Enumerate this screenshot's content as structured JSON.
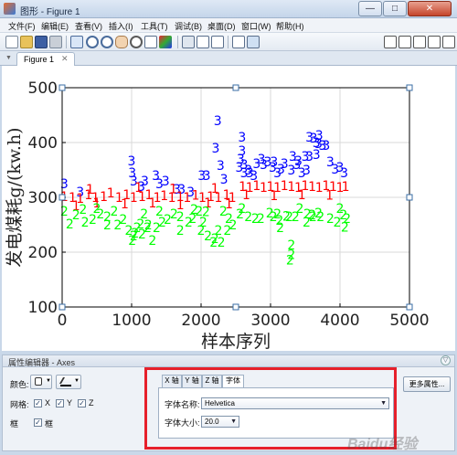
{
  "window": {
    "title": "图形 - Figure 1",
    "min": "—",
    "max": "□",
    "close": "✕"
  },
  "menu": [
    "文件(F)",
    "编辑(E)",
    "查看(V)",
    "插入(I)",
    "工具(T)",
    "调试(B)",
    "桌面(D)",
    "窗口(W)",
    "帮助(H)"
  ],
  "tab": {
    "label": "Figure 1",
    "close": "✕"
  },
  "chart_data": {
    "type": "scatter",
    "xlabel": "样本序列",
    "ylabel": "发电煤耗g/(kw.h)",
    "xlim": [
      0,
      5000
    ],
    "ylim": [
      100,
      500
    ],
    "xticks": [
      "0",
      "1000",
      "2000",
      "3000",
      "4000",
      "5000"
    ],
    "yticks": [
      "100",
      "200",
      "300",
      "400",
      "500"
    ],
    "grid": true,
    "series": [
      {
        "marker": "3",
        "color": "#0000ff",
        "points": [
          [
            30,
            325
          ],
          [
            260,
            310
          ],
          [
            1000,
            367
          ],
          [
            1010,
            345
          ],
          [
            1030,
            330
          ],
          [
            1140,
            320
          ],
          [
            1190,
            330
          ],
          [
            1350,
            340
          ],
          [
            1400,
            325
          ],
          [
            1490,
            330
          ],
          [
            1650,
            315
          ],
          [
            1720,
            315
          ],
          [
            1850,
            310
          ],
          [
            2010,
            340
          ],
          [
            2080,
            340
          ],
          [
            2210,
            390
          ],
          [
            2280,
            358
          ],
          [
            2330,
            333
          ],
          [
            2570,
            370
          ],
          [
            2620,
            345
          ],
          [
            2700,
            345
          ],
          [
            2760,
            340
          ],
          [
            2870,
            370
          ],
          [
            2960,
            365
          ],
          [
            3030,
            355
          ],
          [
            3100,
            345
          ],
          [
            3200,
            362
          ],
          [
            3320,
            375
          ],
          [
            3400,
            367
          ],
          [
            3500,
            375
          ],
          [
            3560,
            375
          ],
          [
            3660,
            400
          ],
          [
            3690,
            398
          ],
          [
            3750,
            395
          ],
          [
            3800,
            395
          ],
          [
            3860,
            365
          ],
          [
            3930,
            352
          ],
          [
            4000,
            355
          ],
          [
            4060,
            345
          ],
          [
            3560,
            410
          ],
          [
            3620,
            408
          ],
          [
            3700,
            413
          ],
          [
            3520,
            350
          ],
          [
            3450,
            345
          ],
          [
            3300,
            350
          ],
          [
            3150,
            352
          ],
          [
            3050,
            365
          ],
          [
            2900,
            360
          ],
          [
            2800,
            362
          ],
          [
            2620,
            360
          ],
          [
            2550,
            355
          ],
          [
            2240,
            440
          ],
          [
            2590,
            410
          ],
          [
            2590,
            385
          ],
          [
            3660,
            378
          ],
          [
            3380,
            360
          ],
          [
            2680,
            350
          ]
        ]
      },
      {
        "marker": "1",
        "color": "#ff0000",
        "points": [
          [
            30,
            302
          ],
          [
            150,
            300
          ],
          [
            260,
            298
          ],
          [
            380,
            305
          ],
          [
            480,
            300
          ],
          [
            600,
            302
          ],
          [
            700,
            308
          ],
          [
            820,
            300
          ],
          [
            930,
            305
          ],
          [
            1030,
            300
          ],
          [
            1150,
            302
          ],
          [
            1250,
            305
          ],
          [
            1370,
            300
          ],
          [
            1470,
            303
          ],
          [
            1580,
            300
          ],
          [
            1700,
            302
          ],
          [
            1800,
            300
          ],
          [
            1920,
            304
          ],
          [
            2020,
            300
          ],
          [
            2140,
            302
          ],
          [
            2250,
            300
          ],
          [
            2370,
            305
          ],
          [
            2450,
            300
          ],
          [
            2600,
            320
          ],
          [
            2700,
            318
          ],
          [
            2800,
            322
          ],
          [
            2900,
            318
          ],
          [
            3000,
            320
          ],
          [
            3100,
            318
          ],
          [
            3200,
            322
          ],
          [
            3300,
            320
          ],
          [
            3400,
            318
          ],
          [
            3500,
            322
          ],
          [
            3600,
            320
          ],
          [
            3700,
            318
          ],
          [
            3800,
            322
          ],
          [
            3900,
            320
          ],
          [
            4000,
            318
          ],
          [
            4080,
            320
          ],
          [
            200,
            285
          ],
          [
            500,
            290
          ],
          [
            900,
            288
          ],
          [
            1300,
            290
          ],
          [
            1700,
            287
          ],
          [
            2100,
            290
          ],
          [
            2400,
            288
          ],
          [
            2650,
            305
          ],
          [
            3050,
            303
          ],
          [
            3450,
            305
          ],
          [
            3850,
            304
          ],
          [
            400,
            315
          ],
          [
            1100,
            318
          ],
          [
            1600,
            316
          ],
          [
            2200,
            317
          ]
        ]
      },
      {
        "marker": "2",
        "color": "#00ff00",
        "points": [
          [
            30,
            275
          ],
          [
            110,
            252
          ],
          [
            200,
            268
          ],
          [
            330,
            255
          ],
          [
            440,
            260
          ],
          [
            550,
            270
          ],
          [
            650,
            265
          ],
          [
            800,
            250
          ],
          [
            880,
            260
          ],
          [
            960,
            240
          ],
          [
            1030,
            230
          ],
          [
            1080,
            245
          ],
          [
            1180,
            270
          ],
          [
            1240,
            250
          ],
          [
            1360,
            245
          ],
          [
            1440,
            255
          ],
          [
            1520,
            260
          ],
          [
            1610,
            270
          ],
          [
            1700,
            265
          ],
          [
            1820,
            255
          ],
          [
            1880,
            262
          ],
          [
            1970,
            275
          ],
          [
            2030,
            255
          ],
          [
            2100,
            230
          ],
          [
            2200,
            225
          ],
          [
            2250,
            240
          ],
          [
            2320,
            275
          ],
          [
            2400,
            262
          ],
          [
            2460,
            250
          ],
          [
            1130,
            252
          ],
          [
            1150,
            233
          ],
          [
            1300,
            222
          ],
          [
            1010,
            222
          ],
          [
            1050,
            235
          ],
          [
            2180,
            218
          ],
          [
            2290,
            218
          ],
          [
            2590,
            280
          ],
          [
            2680,
            265
          ],
          [
            2780,
            262
          ],
          [
            2860,
            262
          ],
          [
            2990,
            272
          ],
          [
            3040,
            265
          ],
          [
            3130,
            258
          ],
          [
            3230,
            266
          ],
          [
            3360,
            265
          ],
          [
            3420,
            280
          ],
          [
            3530,
            270
          ],
          [
            3610,
            265
          ],
          [
            3690,
            272
          ],
          [
            3720,
            265
          ],
          [
            3860,
            262
          ],
          [
            3960,
            255
          ],
          [
            4000,
            280
          ],
          [
            4050,
            268
          ],
          [
            4100,
            262
          ],
          [
            3270,
            265
          ],
          [
            3300,
            213
          ],
          [
            3300,
            196
          ],
          [
            3280,
            186
          ],
          [
            4070,
            246
          ],
          [
            3600,
            268
          ],
          [
            3100,
            270
          ],
          [
            2560,
            270
          ],
          [
            500,
            280
          ],
          [
            1400,
            275
          ],
          [
            300,
            278
          ],
          [
            1900,
            278
          ],
          [
            750,
            275
          ],
          [
            2070,
            274
          ],
          [
            1230,
            245
          ],
          [
            2000,
            240
          ],
          [
            3140,
            245
          ],
          [
            3520,
            255
          ],
          [
            650,
            250
          ],
          [
            1700,
            240
          ],
          [
            2380,
            240
          ]
        ]
      }
    ]
  },
  "property_editor": {
    "title": "属性编辑器 - Axes",
    "collapse_icon": "▽",
    "color_label": "颜色:",
    "grid_label": "网格:",
    "grid_x": "X",
    "grid_y": "Y",
    "grid_z": "Z",
    "box_label": "框",
    "box_check": "框",
    "tabs": [
      "X 轴",
      "Y 轴",
      "Z 轴",
      "字体"
    ],
    "font_name_label": "字体名称:",
    "font_name_value": "Helvetica",
    "font_size_label": "字体大小:",
    "font_size_value": "20.0",
    "more_props": "更多属性..."
  },
  "watermark": "Baidu经验"
}
